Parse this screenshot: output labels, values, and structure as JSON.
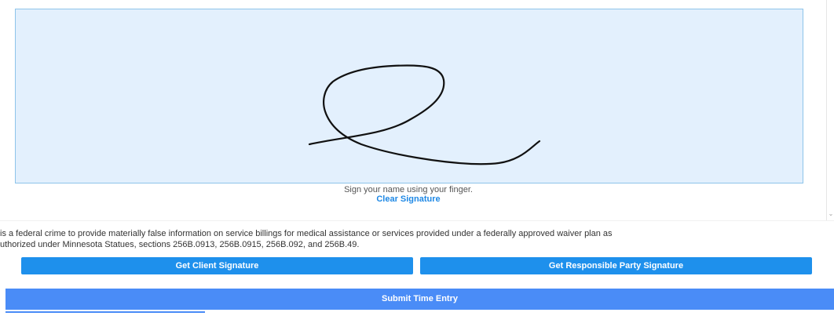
{
  "signature_pad": {
    "instruction": "Sign your name using your finger.",
    "clear_label": "Clear Signature"
  },
  "legal": {
    "line1": "is a federal crime to provide materially false information on service billings for medical assistance or services provided under a federally approved waiver plan as",
    "line2": "uthorized under Minnesota Statues, sections 256B.0913, 256B.0915, 256B.092, and 256B.49."
  },
  "buttons": {
    "client_signature": "Get Client Signature",
    "responsible_party_signature": "Get Responsible Party Signature",
    "submit": "Submit Time Entry"
  },
  "colors": {
    "canvas_background": "#e3f0fd",
    "canvas_border": "#8ec4ea",
    "signature_ink": "#111111",
    "primary_button": "#1e90ec",
    "submit_button": "#4a8cf7",
    "link": "#1e88e5"
  },
  "icons": {
    "scroll_down": "chevron-down-icon"
  }
}
